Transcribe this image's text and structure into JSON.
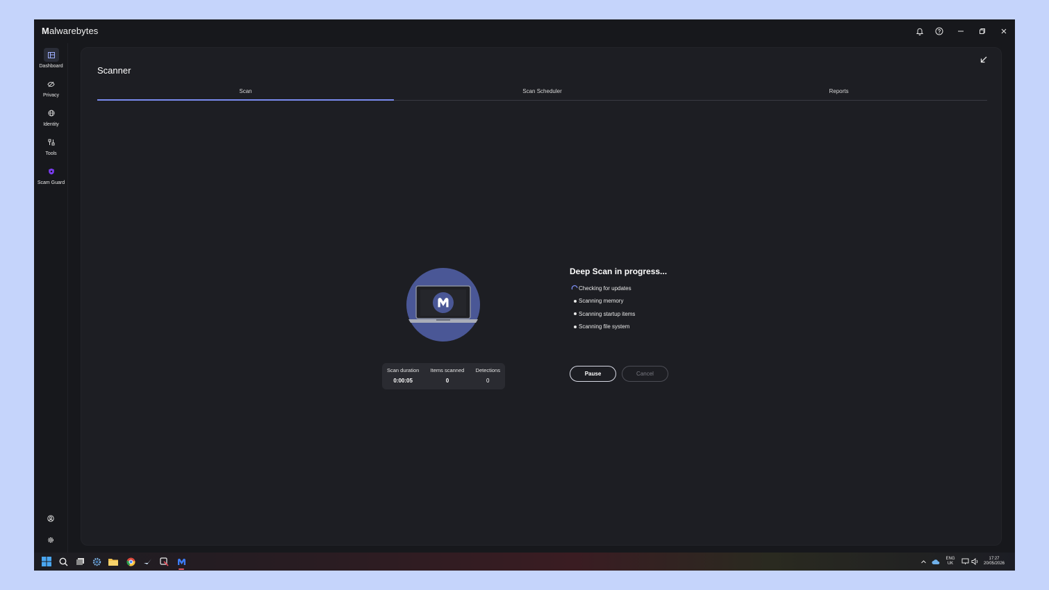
{
  "app": {
    "brand_bold": "M",
    "brand_name": "alwarebytes"
  },
  "sidebar": {
    "items": [
      {
        "label": "Dashboard",
        "icon": "dashboard-icon"
      },
      {
        "label": "Privacy",
        "icon": "eye-off-icon"
      },
      {
        "label": "Identity",
        "icon": "globe-icon"
      },
      {
        "label": "Tools",
        "icon": "tools-icon"
      },
      {
        "label": "Scam Guard",
        "icon": "shield-icon"
      }
    ],
    "bottom_icons": [
      "account-icon",
      "settings-icon"
    ]
  },
  "header": {
    "title": "Scanner"
  },
  "tabs": [
    {
      "label": "Scan",
      "active": true
    },
    {
      "label": "Scan Scheduler",
      "active": false
    },
    {
      "label": "Reports",
      "active": false
    }
  ],
  "stats": {
    "duration_label": "Scan duration",
    "duration_value": "0:00:05",
    "items_label": "Items scanned",
    "items_value": "0",
    "detections_label": "Detections",
    "detections_value": "0"
  },
  "progress": {
    "title": "Deep Scan in progress...",
    "steps": [
      {
        "label": "Checking for updates",
        "state": "active"
      },
      {
        "label": "Scanning memory",
        "state": "pending"
      },
      {
        "label": "Scanning startup items",
        "state": "pending"
      },
      {
        "label": "Scanning file system",
        "state": "pending"
      }
    ]
  },
  "buttons": {
    "pause": "Pause",
    "cancel": "Cancel"
  },
  "tray": {
    "lang_top": "ENG",
    "lang_bottom": "UK",
    "time": "17:27",
    "date": "20/05/2026"
  },
  "colors": {
    "accent": "#7b8cf0",
    "background": "#17181c",
    "panel": "#1d1e23",
    "desktop": "#c5d4fb"
  }
}
